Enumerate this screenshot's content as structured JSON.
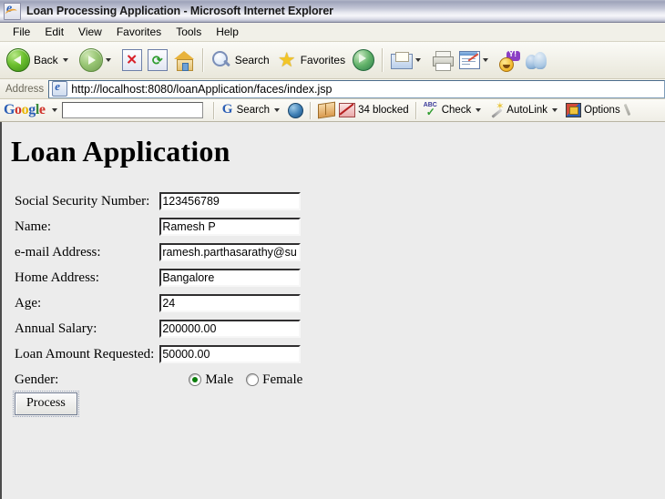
{
  "window": {
    "title": "Loan Processing Application - Microsoft Internet Explorer",
    "icon": "ie-page-icon"
  },
  "menu": {
    "items": [
      {
        "label": "File"
      },
      {
        "label": "Edit"
      },
      {
        "label": "View"
      },
      {
        "label": "Favorites"
      },
      {
        "label": "Tools"
      },
      {
        "label": "Help"
      }
    ]
  },
  "toolbar": {
    "back_label": "Back",
    "search_label": "Search",
    "favorites_label": "Favorites",
    "icons": [
      "back-arrow-icon",
      "forward-arrow-icon",
      "stop-icon",
      "refresh-icon",
      "home-icon",
      "search-icon",
      "favorites-star-icon",
      "media-icon",
      "mail-icon",
      "print-icon",
      "edit-page-icon",
      "yahoo-messenger-icon",
      "msn-messenger-icon"
    ]
  },
  "address": {
    "label": "Address",
    "url": "http://localhost:8080/loanApplication/faces/index.jsp"
  },
  "google_toolbar": {
    "logo": {
      "g1": "G",
      "o1": "o",
      "o2": "o",
      "g2": "g",
      "l": "l",
      "e": "e"
    },
    "search_value": "",
    "search_label": "Search",
    "blocked_label": "34 blocked",
    "check_label": "Check",
    "autolink_label": "AutoLink",
    "options_label": "Options"
  },
  "page": {
    "heading": "Loan Application",
    "fields": [
      {
        "label": "Social Security Number:",
        "value": "123456789",
        "name": "ssn"
      },
      {
        "label": "Name:",
        "value": "Ramesh P",
        "name": "name"
      },
      {
        "label": "e-mail Address:",
        "value": "ramesh.parthasarathy@su",
        "name": "email"
      },
      {
        "label": "Home Address:",
        "value": "Bangalore",
        "name": "home-address"
      },
      {
        "label": "Age:",
        "value": "24",
        "name": "age"
      },
      {
        "label": "Annual Salary:",
        "value": "200000.00",
        "name": "annual-salary"
      },
      {
        "label": "Loan Amount Requested:",
        "value": "50000.00",
        "name": "loan-amount"
      }
    ],
    "gender": {
      "label": "Gender:",
      "options": [
        {
          "label": "Male",
          "selected": true
        },
        {
          "label": "Female",
          "selected": false
        }
      ]
    },
    "submit_label": "Process"
  },
  "colors": {
    "page_background": "#ececec",
    "title_accent": "#9ea3ba",
    "radio_selected": "#0b7d0b",
    "link_blue": "#2b5eb5"
  }
}
